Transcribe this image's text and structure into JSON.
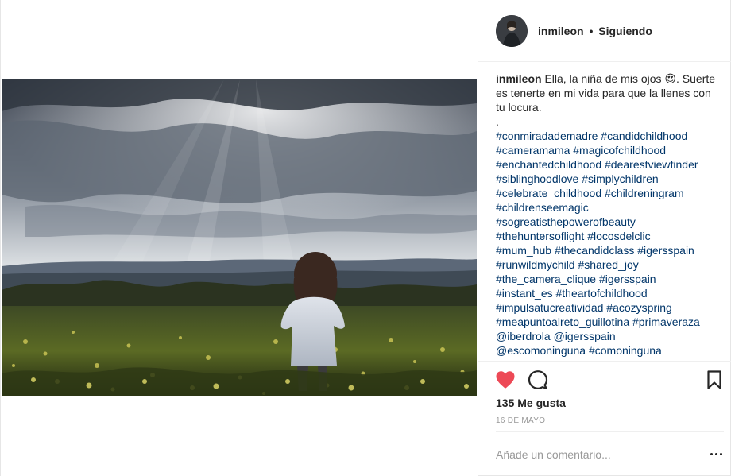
{
  "post": {
    "photo_alt": "Ella, la niña de mis ojos"
  },
  "header": {
    "username": "inmileon",
    "separator": "•",
    "follow_status": "Siguiendo",
    "avatar_icon": "profile-avatar"
  },
  "caption": {
    "username": "inmileon",
    "text_line1": "Ella, la niña de mis ojos 😍.",
    "text_line2": "Suerte es tenerte en mi vida para que la llenes con tu locura.",
    "dot": ".",
    "hashtags": [
      "#conmiradademadre",
      "#candidchildhood",
      "#cameramama",
      "#magicofchildhood",
      "#enchantedchildhood",
      "#dearestviewfinder",
      "#siblinghoodlove",
      "#simplychildren",
      "#celebrate_childhood",
      "#childreningram",
      "#childrenseemagic",
      "#sogreatisthepowerofbeauty",
      "#thehuntersoflight",
      "#locosdelclic",
      "#mum_hub",
      "#thecandidclass",
      "#igersspain",
      "#runwildmychild",
      "#shared_joy",
      "#the_camera_clique",
      "#igersspain",
      "#instant_es",
      "#theartofchildhood",
      "#impulsatucreatividad",
      "#acozyspring",
      "#meapuntoalreto_guillotina",
      "#primaveraza",
      "@iberdrola",
      "@igersspain",
      "@escomoninguna",
      "#comoninguna"
    ]
  },
  "actions": {
    "like_icon": "heart-filled",
    "like_color": "#ed4956",
    "comment_icon": "speech-bubble",
    "save_icon": "bookmark"
  },
  "likes": "135 Me gusta",
  "date": "16 DE MAYO",
  "comment": {
    "placeholder": "Añade un comentario...",
    "more_icon": "ellipsis"
  },
  "colors": {
    "text": "#262626",
    "hashtag": "#003569",
    "muted": "#999999",
    "divider": "#efefef"
  }
}
